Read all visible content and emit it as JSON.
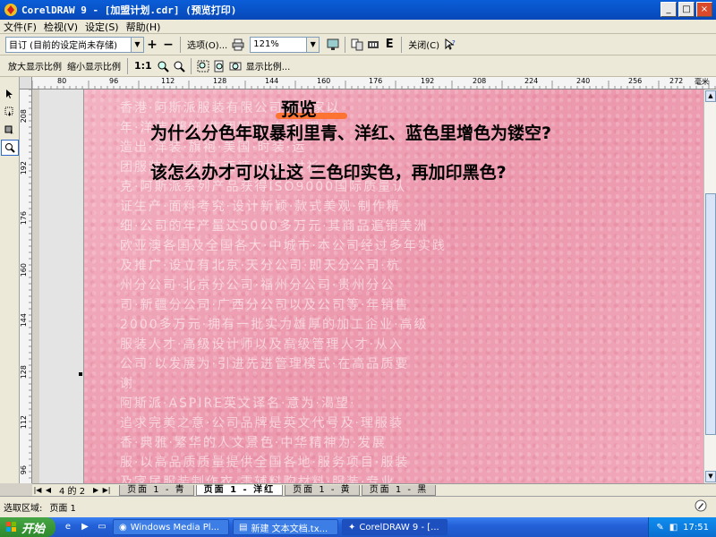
{
  "window": {
    "title": "CorelDRAW 9 - [加盟计划.cdr] (预览打印)",
    "controls": [
      "_",
      "□",
      "×"
    ]
  },
  "menu": [
    "文件(F)",
    "检视(V)",
    "设定(S)",
    "帮助(H)"
  ],
  "toolbar1": {
    "preset_value": "目订 (目前的设定尚未存储)",
    "add_label": "+",
    "remove_label": "−",
    "options_label": "选项(O)...",
    "zoom_value": "121%",
    "close_label": "关闭(C)"
  },
  "toolbar2": {
    "zoom_in_label": "放大显示比例",
    "zoom_out_label": "缩小显示比例",
    "one_to_one_label": "1:1",
    "display_ratio_label": "显示比例..."
  },
  "ruler_h": [
    "80",
    "96",
    "112",
    "128",
    "144",
    "160",
    "176",
    "192",
    "208",
    "224",
    "240",
    "256",
    "272",
    "毫米"
  ],
  "ruler_v": [
    "208",
    "192",
    "176",
    "160",
    "144",
    "128",
    "112",
    "96"
  ],
  "page": {
    "heading": "预览",
    "question_line1": "为什么分色年取暴利里青、洋红、蓝色里增色为镂空?",
    "question_line2": "该怎么办才可以让这 三色印实色，再加印黑色?",
    "ghost_lines": [
      "香港·阿斯派服装有限公司是一家以",
      "年·洋装·服饰·集团服装·女装·理",
      "造出·洋装·旗袍·美国·时装·运",
      "团服装·大·西装·西裤·时装·衬衫·",
      "克·阿斯派系列产品获得ISO9000国际质量认",
      "证生产·面料考究·设计新颖·款式美观·制作精",
      "细·公司的年产量达5000多万元·其商品遍销美洲",
      "欧亚澳各国及全国各大·中城市·本公司经过多年实践",
      "及推广·设立有北京·天分公司·即天分公司·杭",
      "州分公司·北京分公司·福州分公司·贵州分公",
      "司·新疆分公司·广西分公司以及公司等·年销售",
      "2000多万元·拥有一批实力雄厚的加工企业·高级",
      "服装人才·高级设计师以及高级管理人才·从入",
      "公司·以发展为·引进先进管理模式·在高品质要",
      "谢",
      "阿斯派·ASPIRE英文译名·意为·渴望·",
      "追求完美之意·公司品牌是英文代号及·理服装",
      "香·典雅·繁华的人文景色·中华精神为·发展",
      "服·以高品质质量提供全国各地·服务项目·服装",
      "及家居服装制作衣·零辅料购材料·服装·专业"
    ]
  },
  "page_tabs": {
    "counter": "4 的 2",
    "tabs": [
      "页面 1 - 青",
      "页面 1 - 洋红",
      "页面 1 - 黄",
      "页面 1 - 黑"
    ],
    "active_index": 1
  },
  "status": {
    "selection_label": "选取区域:",
    "selection_value": "页面 1"
  },
  "taskbar": {
    "start_label": "开始",
    "tasks": [
      {
        "label": "Windows Media Pl...",
        "active": false
      },
      {
        "label": "新建 文本文档.tx...",
        "active": false
      },
      {
        "label": "CorelDRAW 9 - [...",
        "active": true
      }
    ],
    "clock": "17:51"
  },
  "icons": {
    "app": "coreldraw-icon",
    "add": "plus-icon",
    "remove": "minus-icon",
    "print": "printer-icon",
    "help": "help-pointer-icon"
  }
}
